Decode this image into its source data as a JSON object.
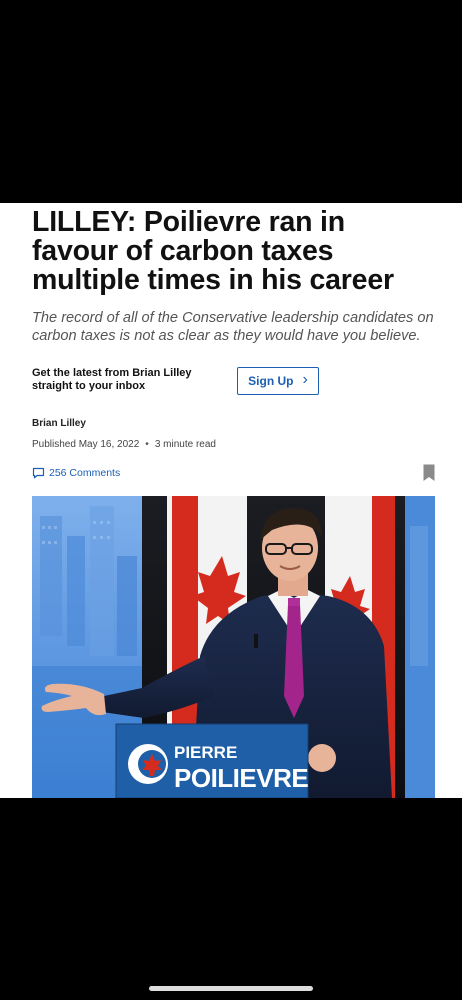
{
  "article": {
    "headline": "LILLEY: Poilievre ran in favour of carbon taxes multiple times in his career",
    "deck": "The record of all of the Conservative leadership candidates on carbon taxes is not as clear as they would have you believe.",
    "newsletter_prompt": "Get the latest from Brian Lilley straight to your inbox",
    "signup_label": "Sign Up",
    "author": "Brian Lilley",
    "published": "Published May 16, 2022",
    "read_time": "3 minute read",
    "comments_label": "256 Comments",
    "photo": {
      "podium_line1": "PIERRE",
      "podium_line2": "POILIEVRE"
    }
  },
  "colors": {
    "link_blue": "#1a5fb4",
    "podium_blue": "#1f5fa8",
    "flag_red": "#d52b1e"
  }
}
